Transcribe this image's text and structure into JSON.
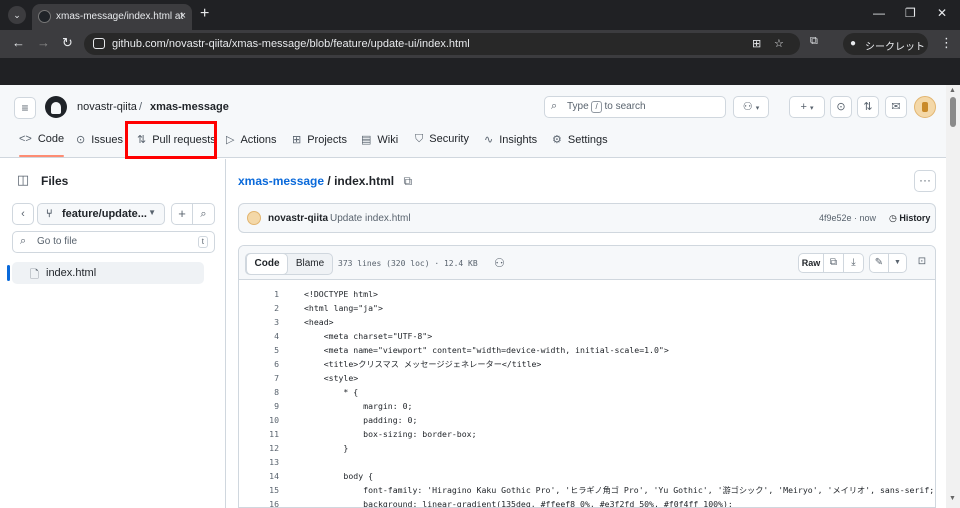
{
  "browser": {
    "tab_title": "xmas-message/index.html at",
    "new_tab": "+",
    "url": "github.com/novastr-qiita/xmas-message/blob/feature/update-ui/index.html",
    "incognito_label": "シークレット"
  },
  "header": {
    "owner": "novastr-qiita",
    "separator": "/",
    "repo": "xmas-message",
    "search_type": "Type",
    "search_key": "/",
    "search_rest": "to search"
  },
  "repo_tabs": [
    {
      "label": "Code",
      "icon": "code-icon"
    },
    {
      "label": "Issues",
      "icon": "issue-icon"
    },
    {
      "label": "Pull requests",
      "icon": "pull-request-icon"
    },
    {
      "label": "Actions",
      "icon": "play-icon"
    },
    {
      "label": "Projects",
      "icon": "table-icon"
    },
    {
      "label": "Wiki",
      "icon": "book-icon"
    },
    {
      "label": "Security",
      "icon": "shield-icon"
    },
    {
      "label": "Insights",
      "icon": "graph-icon"
    },
    {
      "label": "Settings",
      "icon": "gear-icon"
    }
  ],
  "annotation": {
    "highlight_color": "#ff0000",
    "arrow_color": "#cc0000",
    "arrow_outline": "#1f3a93"
  },
  "sidebar": {
    "title": "Files",
    "branch": "feature/update...",
    "goto_placeholder": "Go to file",
    "goto_key": "t",
    "files": [
      "index.html"
    ]
  },
  "file": {
    "repo_link": "xmas-message",
    "path_sep": "/",
    "name": "index.html",
    "commit_author": "novastr-qiita",
    "commit_message": "Update index.html",
    "commit_hash": "4f9e52e · now",
    "history_label": "History",
    "view_code": "Code",
    "view_blame": "Blame",
    "meta": "373 lines (320 loc) · 12.4 KB",
    "raw_label": "Raw"
  },
  "code_lines": [
    {
      "n": "1",
      "t": "<!DOCTYPE html>"
    },
    {
      "n": "2",
      "t": "<html lang=\"ja\">"
    },
    {
      "n": "3",
      "t": "<head>"
    },
    {
      "n": "4",
      "t": "    <meta charset=\"UTF-8\">"
    },
    {
      "n": "5",
      "t": "    <meta name=\"viewport\" content=\"width=device-width, initial-scale=1.0\">"
    },
    {
      "n": "6",
      "t": "    <title>クリスマス メッセージジェネレーター</title>"
    },
    {
      "n": "7",
      "t": "    <style>"
    },
    {
      "n": "8",
      "t": "        * {"
    },
    {
      "n": "9",
      "t": "            margin: 0;"
    },
    {
      "n": "10",
      "t": "            padding: 0;"
    },
    {
      "n": "11",
      "t": "            box-sizing: border-box;"
    },
    {
      "n": "12",
      "t": "        }"
    },
    {
      "n": "13",
      "t": ""
    },
    {
      "n": "14",
      "t": "        body {"
    },
    {
      "n": "15",
      "t": "            font-family: 'Hiragino Kaku Gothic Pro', 'ヒラギノ角ゴ Pro', 'Yu Gothic', '游ゴシック', 'Meiryo', 'メイリオ', sans-serif;"
    },
    {
      "n": "16",
      "t": "            background: linear-gradient(135deg, #ffeef8 0%, #e3f2fd 50%, #f0f4ff 100%);"
    }
  ]
}
